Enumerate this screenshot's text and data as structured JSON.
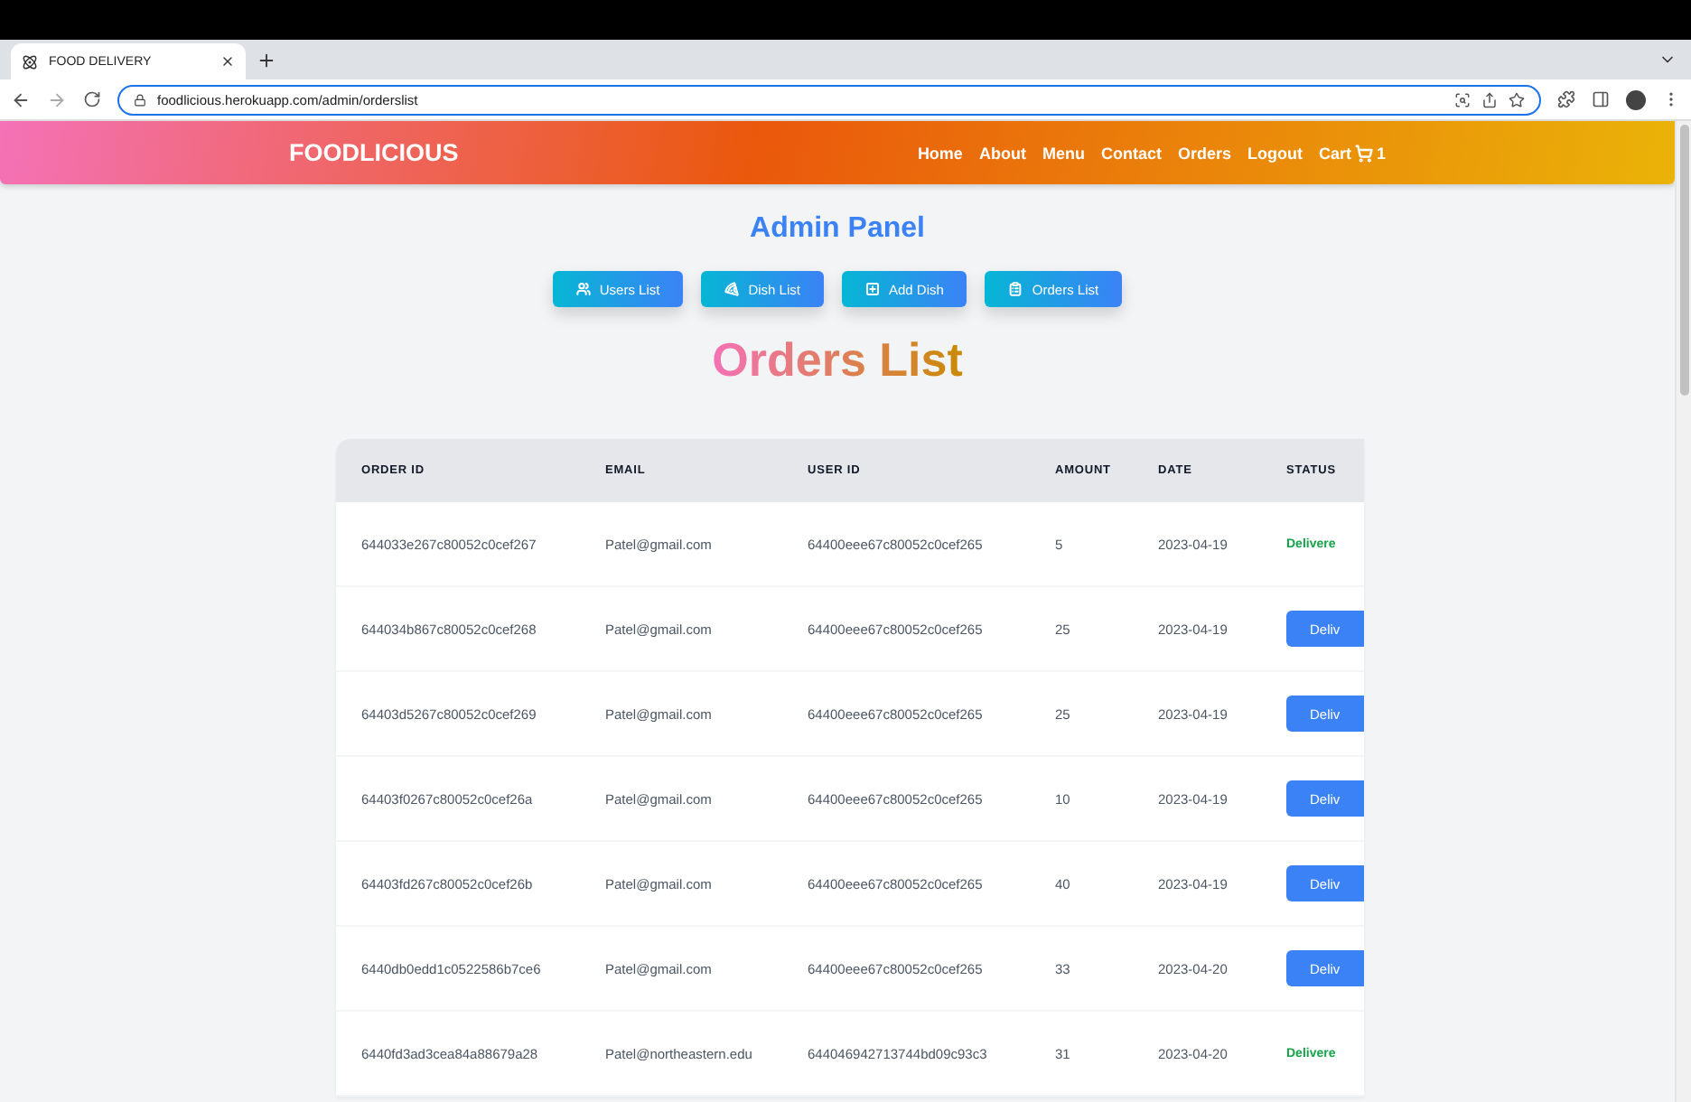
{
  "browser": {
    "tab": {
      "title": "FOOD DELIVERY",
      "selected": true
    },
    "url": "foodlicious.herokuapp.com/admin/orderslist"
  },
  "navbar": {
    "brand": "FOODLICIOUS",
    "links": [
      "Home",
      "About",
      "Menu",
      "Contact",
      "Orders",
      "Logout"
    ],
    "cart": {
      "label": "Cart",
      "count": "1"
    }
  },
  "heading": "Admin Panel",
  "admin_buttons": [
    {
      "label": "Users List",
      "kind": "users"
    },
    {
      "label": "Dish List",
      "kind": "dish"
    },
    {
      "label": "Add Dish",
      "kind": "add"
    },
    {
      "label": "Orders List",
      "kind": "orders"
    }
  ],
  "title": "Orders List",
  "table": {
    "columns": [
      "ORDER ID",
      "EMAIL",
      "USER ID",
      "AMOUNT",
      "DATE",
      "STATUS"
    ],
    "rows": [
      {
        "order_id": "644033e267c80052c0cef267",
        "email": "Patel@gmail.com",
        "user_id": "64400eee67c80052c0cef265",
        "amount": "5",
        "date": "2023-04-19",
        "status": {
          "kind": "text",
          "label": "Delivere"
        }
      },
      {
        "order_id": "644034b867c80052c0cef268",
        "email": "Patel@gmail.com",
        "user_id": "64400eee67c80052c0cef265",
        "amount": "25",
        "date": "2023-04-19",
        "status": {
          "kind": "button",
          "label": "Deliv"
        }
      },
      {
        "order_id": "64403d5267c80052c0cef269",
        "email": "Patel@gmail.com",
        "user_id": "64400eee67c80052c0cef265",
        "amount": "25",
        "date": "2023-04-19",
        "status": {
          "kind": "button",
          "label": "Deliv"
        }
      },
      {
        "order_id": "64403f0267c80052c0cef26a",
        "email": "Patel@gmail.com",
        "user_id": "64400eee67c80052c0cef265",
        "amount": "10",
        "date": "2023-04-19",
        "status": {
          "kind": "button",
          "label": "Deliv"
        }
      },
      {
        "order_id": "64403fd267c80052c0cef26b",
        "email": "Patel@gmail.com",
        "user_id": "64400eee67c80052c0cef265",
        "amount": "40",
        "date": "2023-04-19",
        "status": {
          "kind": "button",
          "label": "Deliv"
        }
      },
      {
        "order_id": "6440db0edd1c0522586b7ce6",
        "email": "Patel@gmail.com",
        "user_id": "64400eee67c80052c0cef265",
        "amount": "33",
        "date": "2023-04-20",
        "status": {
          "kind": "button",
          "label": "Deliv"
        }
      },
      {
        "order_id": "6440fd3ad3cea84a88679a28",
        "email": "Patel@northeastern.edu",
        "user_id": "644046942713744bd09c93c3",
        "amount": "31",
        "date": "2023-04-20",
        "status": {
          "kind": "text",
          "label": "Delivere"
        }
      }
    ]
  }
}
